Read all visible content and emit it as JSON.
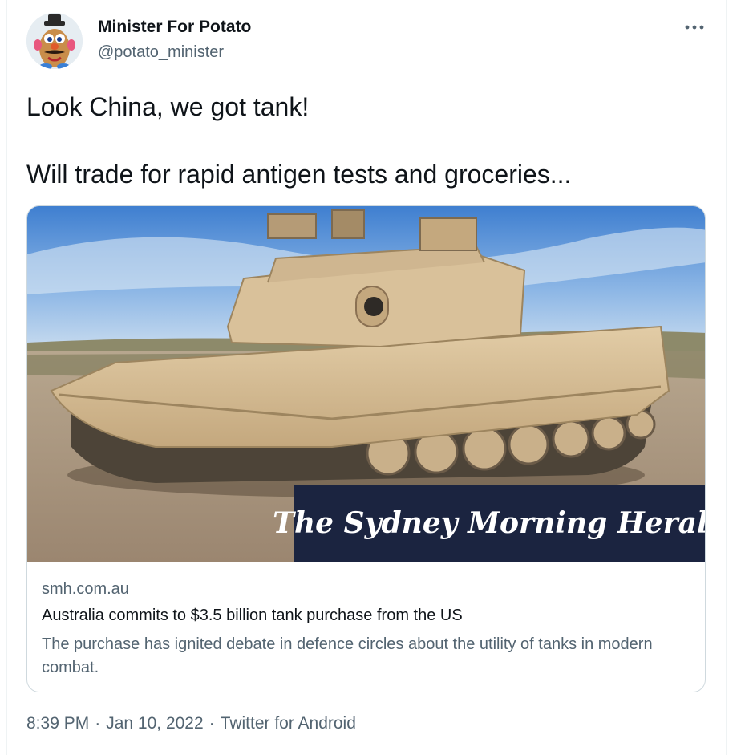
{
  "tweet": {
    "display_name": "Minister For Potato",
    "handle": "@potato_minister",
    "more_icon": "more-horizontal-icon",
    "text_lines": [
      "Look China, we got tank!",
      "Will trade for rapid antigen tests and groceries..."
    ]
  },
  "card": {
    "masthead": "The Sydney Morning Herald",
    "domain": "smh.com.au",
    "title": "Australia commits to $3.5 billion tank purchase from the US",
    "description": "The purchase has ignited debate in defence circles about the utility of tanks in modern combat."
  },
  "meta": {
    "time": "8:39 PM",
    "date": "Jan 10, 2022",
    "source": "Twitter for Android",
    "separator": "·"
  },
  "colors": {
    "text_primary": "#0f1419",
    "text_secondary": "#536471",
    "border": "#cfd9de",
    "masthead_bg": "#1b2440"
  }
}
